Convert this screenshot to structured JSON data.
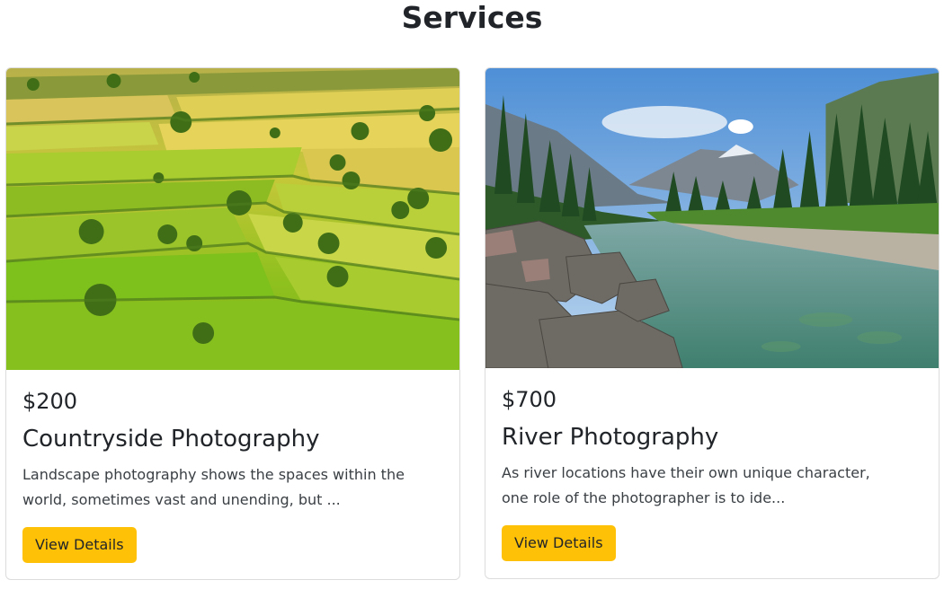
{
  "page": {
    "title": "Services"
  },
  "services": [
    {
      "price": "$200",
      "title": "Countryside Photography",
      "description": "Landscape photography shows the spaces within the world, sometimes vast and unending, but ...",
      "button_label": "View Details",
      "image": "countryside-fields-photo"
    },
    {
      "price": "$700",
      "title": "River Photography",
      "description": "As river locations have their own unique character, one role of the photographer is to ide...",
      "button_label": "View Details",
      "image": "mountain-river-photo"
    }
  ],
  "colors": {
    "button_bg": "#ffc107",
    "text": "#212529",
    "card_border": "#dcdcdc"
  }
}
